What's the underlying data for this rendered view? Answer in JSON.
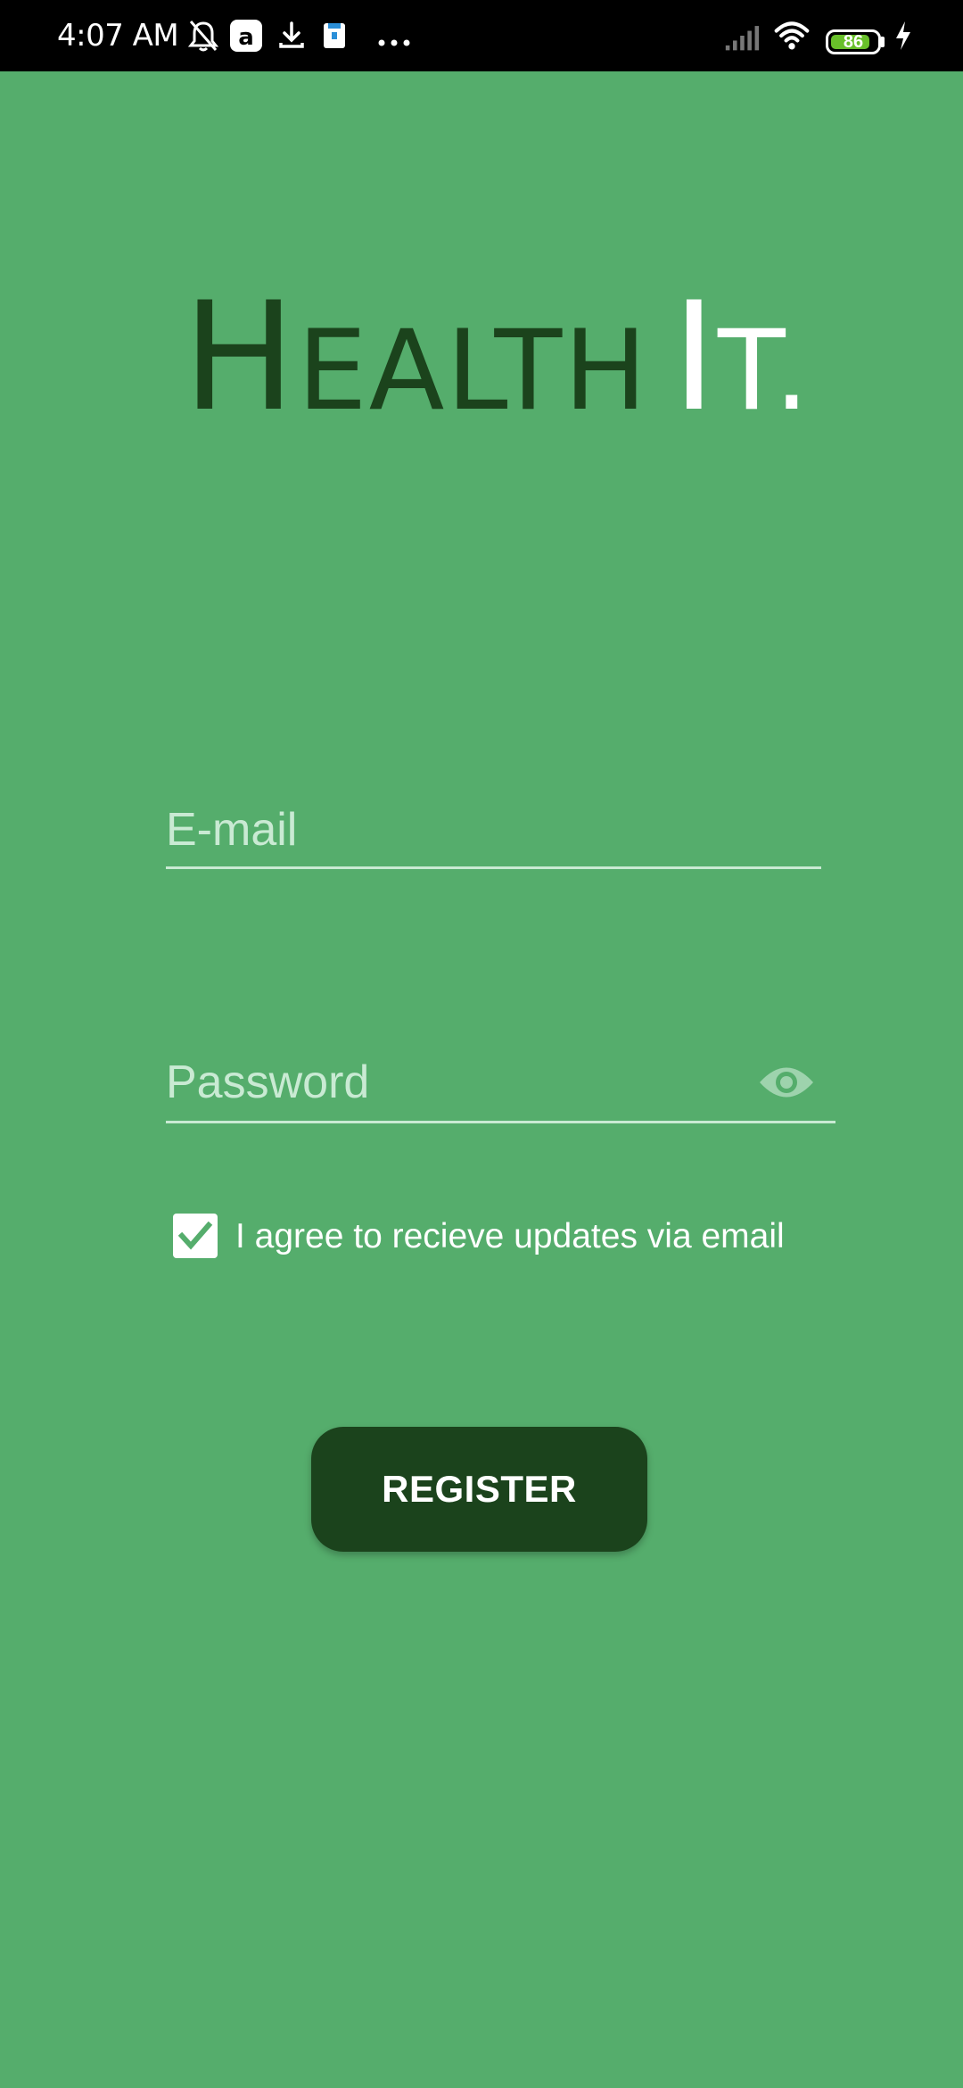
{
  "status_bar": {
    "time": "4:07 AM",
    "notification_icons": [
      "bell-off-icon",
      "amazon-icon",
      "download-icon",
      "clipboard-icon",
      "more-icon"
    ],
    "battery_level": "86",
    "battery_percent": 86,
    "charging": true
  },
  "logo": {
    "part1_initial": "H",
    "part1_rest": "EALTH",
    "part2_initial": "I",
    "part2_rest": "T."
  },
  "form": {
    "email_placeholder": "E-mail",
    "email_value": "",
    "password_placeholder": "Password",
    "password_value": "",
    "agree_checked": true,
    "agree_label": "I agree to recieve updates via email",
    "register_label": "REGISTER"
  },
  "colors": {
    "background": "#55ad6c",
    "logo_dark": "#1b431c",
    "button": "#1b431c",
    "field_line": "#c9ead3",
    "status_bar": "#000000"
  }
}
